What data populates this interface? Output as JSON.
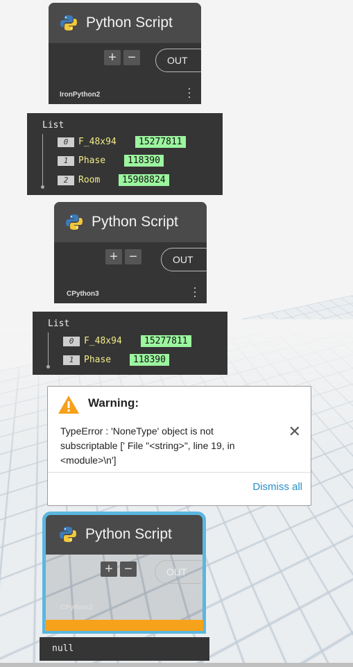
{
  "nodes": [
    {
      "title": "Python Script",
      "engine": "IronPython2",
      "out_label": "OUT"
    },
    {
      "title": "Python Script",
      "engine": "CPython3",
      "out_label": "OUT"
    },
    {
      "title": "Python Script",
      "engine": "CPython3",
      "out_label": "OUT"
    }
  ],
  "preview1": {
    "title": "List",
    "items": [
      {
        "index": "0",
        "name": "F_48x94",
        "value": "15277811"
      },
      {
        "index": "1",
        "name": "Phase",
        "value": "118390"
      },
      {
        "index": "2",
        "name": "Room",
        "value": "15908824"
      }
    ]
  },
  "preview2": {
    "title": "List",
    "items": [
      {
        "index": "0",
        "name": "F_48x94",
        "value": "15277811"
      },
      {
        "index": "1",
        "name": "Phase",
        "value": "118390"
      }
    ]
  },
  "warning": {
    "title": "Warning:",
    "message": "TypeError : 'NoneType' object is not subscriptable ['  File \"<string>\", line 19, in <module>\\n']",
    "dismiss_label": "Dismiss all"
  },
  "null_preview": {
    "value": "null"
  },
  "icons": {
    "python": "python-logo-icon",
    "warning": "warning-triangle-icon",
    "close": "close-icon",
    "menu": "kebab-menu-icon"
  },
  "colors": {
    "selection": "#5ab7df",
    "warning_bar": "#f7a21b",
    "value_bg": "#9cf59f",
    "name_text": "#f2ec8a"
  }
}
